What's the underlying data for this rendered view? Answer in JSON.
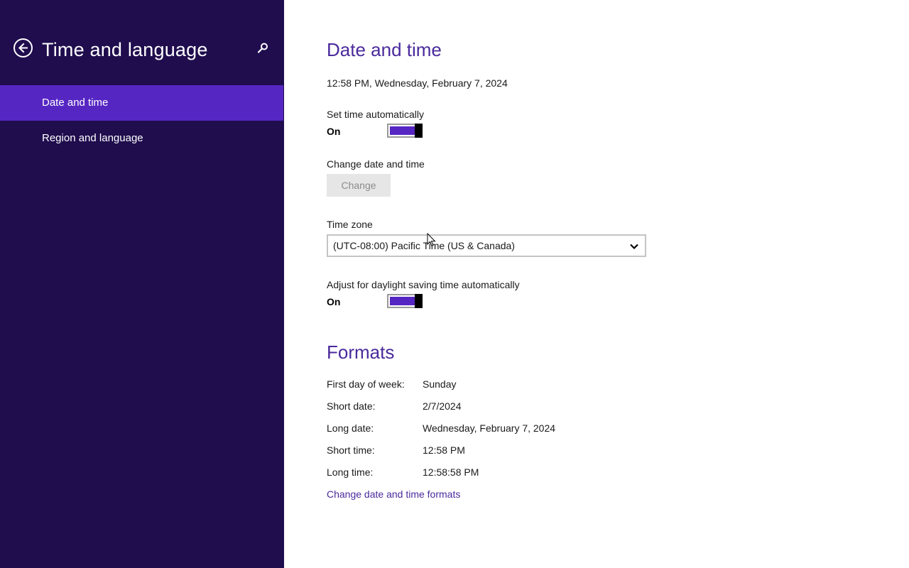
{
  "sidebar": {
    "title": "Time and language",
    "back_icon": "back-arrow-icon",
    "search_icon": "search-icon",
    "items": [
      {
        "label": "Date and time",
        "selected": true
      },
      {
        "label": "Region and language",
        "selected": false
      }
    ]
  },
  "date_time": {
    "title": "Date and time",
    "current": "12:58 PM, Wednesday, February 7, 2024",
    "auto_time_label": "Set time automatically",
    "auto_time_state": "On",
    "change_label": "Change date and time",
    "change_button": "Change",
    "timezone_label": "Time zone",
    "timezone_value": "(UTC-08:00) Pacific Time (US & Canada)",
    "dst_label": "Adjust for daylight saving time automatically",
    "dst_state": "On"
  },
  "formats": {
    "title": "Formats",
    "rows": [
      {
        "label": "First day of week:",
        "value": "Sunday"
      },
      {
        "label": "Short date:",
        "value": "2/7/2024"
      },
      {
        "label": "Long date:",
        "value": "Wednesday, February 7, 2024"
      },
      {
        "label": "Short time:",
        "value": "12:58 PM"
      },
      {
        "label": "Long time:",
        "value": "12:58:58 PM"
      }
    ],
    "link": "Change date and time formats"
  },
  "colors": {
    "sidebar_bg": "#1f0d4e",
    "selected_item": "#5626c3",
    "accent_text": "#4a2a9c"
  }
}
